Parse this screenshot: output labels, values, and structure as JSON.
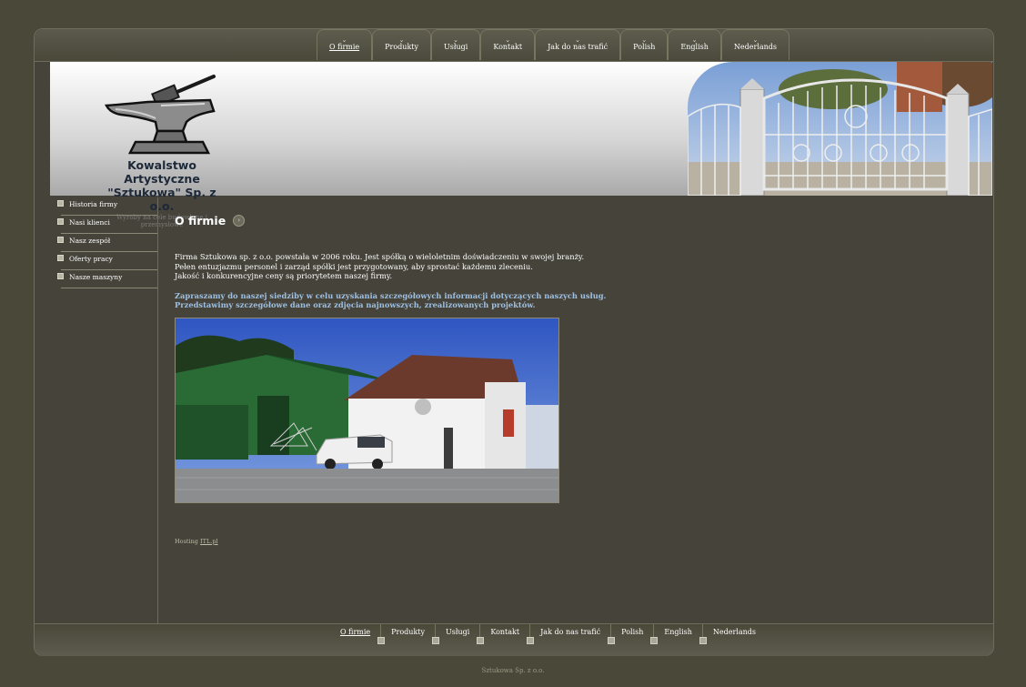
{
  "topnav": [
    {
      "label": "O firmie",
      "active": true
    },
    {
      "label": "Produkty",
      "active": false
    },
    {
      "label": "Usługi",
      "active": false
    },
    {
      "label": "Kontakt",
      "active": false
    },
    {
      "label": "Jak do nas trafić",
      "active": false
    },
    {
      "label": "Polish",
      "active": false
    },
    {
      "label": "English",
      "active": false
    },
    {
      "label": "Nederlands",
      "active": false
    }
  ],
  "header": {
    "company_line1": "Kowalstwo Artystyczne",
    "company_line2": "\"Sztukowa\" Sp. z o.o.",
    "tagline": "Wyroby na cele budowlane i przemysłowe"
  },
  "sidebar": {
    "items": [
      {
        "label": "Historia firmy"
      },
      {
        "label": "Nasi klienci"
      },
      {
        "label": "Nasz zespół"
      },
      {
        "label": "Oferty pracy"
      },
      {
        "label": "Nasze maszyny"
      }
    ]
  },
  "main": {
    "title": "O firmie",
    "intro_lines": [
      "Firma Sztukowa sp. z o.o. powstała w 2006 roku. Jest spółką o wieloletnim doświadczeniu w swojej branży.",
      "Pełen entuzjazmu personel i zarząd spółki jest przygotowany, aby sprostać każdemu zleceniu.",
      "Jakość i konkurencyjne ceny są priorytetem naszej firmy."
    ],
    "highlight_lines": [
      "Zapraszamy do naszej siedziby w celu uzyskania szczegółowych informacji dotyczących naszych usług.",
      "Przedstawimy szczegółowe dane oraz zdjęcia najnowszych, zrealizowanych projektów."
    ],
    "hosting_label": "Hosting",
    "hosting_link": "ITL.pl"
  },
  "bottomnav": [
    {
      "label": "O firmie",
      "active": true
    },
    {
      "label": "Produkty",
      "active": false
    },
    {
      "label": "Usługi",
      "active": false
    },
    {
      "label": "Kontakt",
      "active": false
    },
    {
      "label": "Jak do nas trafić",
      "active": false
    },
    {
      "label": "Polish",
      "active": false
    },
    {
      "label": "English",
      "active": false
    },
    {
      "label": "Nederlands",
      "active": false
    }
  ],
  "footer": {
    "text": "Sztukowa Sp. z o.o."
  },
  "colors": {
    "background": "#4a4839",
    "highlight_text": "#9fc0e2",
    "company_name": "#1d2838"
  }
}
